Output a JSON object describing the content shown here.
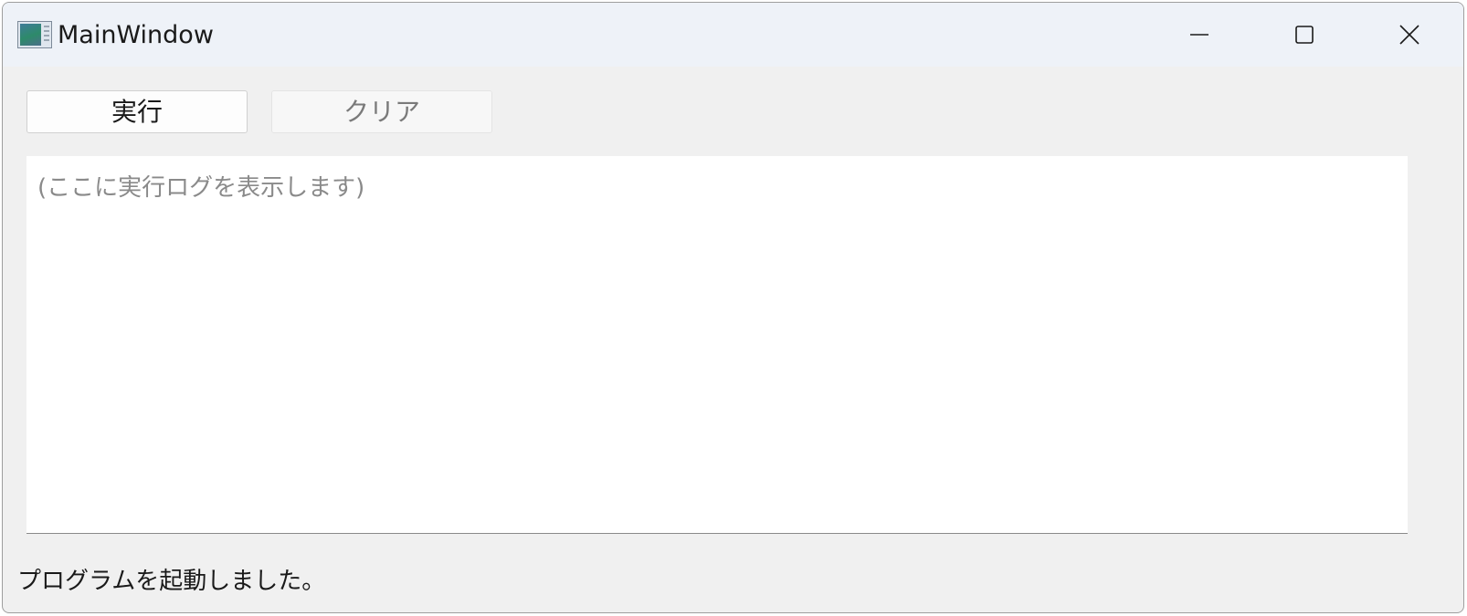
{
  "window": {
    "title": "MainWindow",
    "icon": "app-window-icon",
    "controls": {
      "minimize": "minimize-icon",
      "maximize": "maximize-icon",
      "close": "close-icon"
    }
  },
  "toolbar": {
    "run_label": "実行",
    "clear_label": "クリア",
    "clear_enabled": false
  },
  "log": {
    "placeholder": "(ここに実行ログを表示します)",
    "value": ""
  },
  "status": {
    "text": "プログラムを起動しました。"
  },
  "colors": {
    "titlebar_bg": "#eef2f8",
    "window_bg": "#f0f0f0",
    "disabled_text": "#7a7a7a",
    "placeholder_text": "#8a8a8a"
  }
}
